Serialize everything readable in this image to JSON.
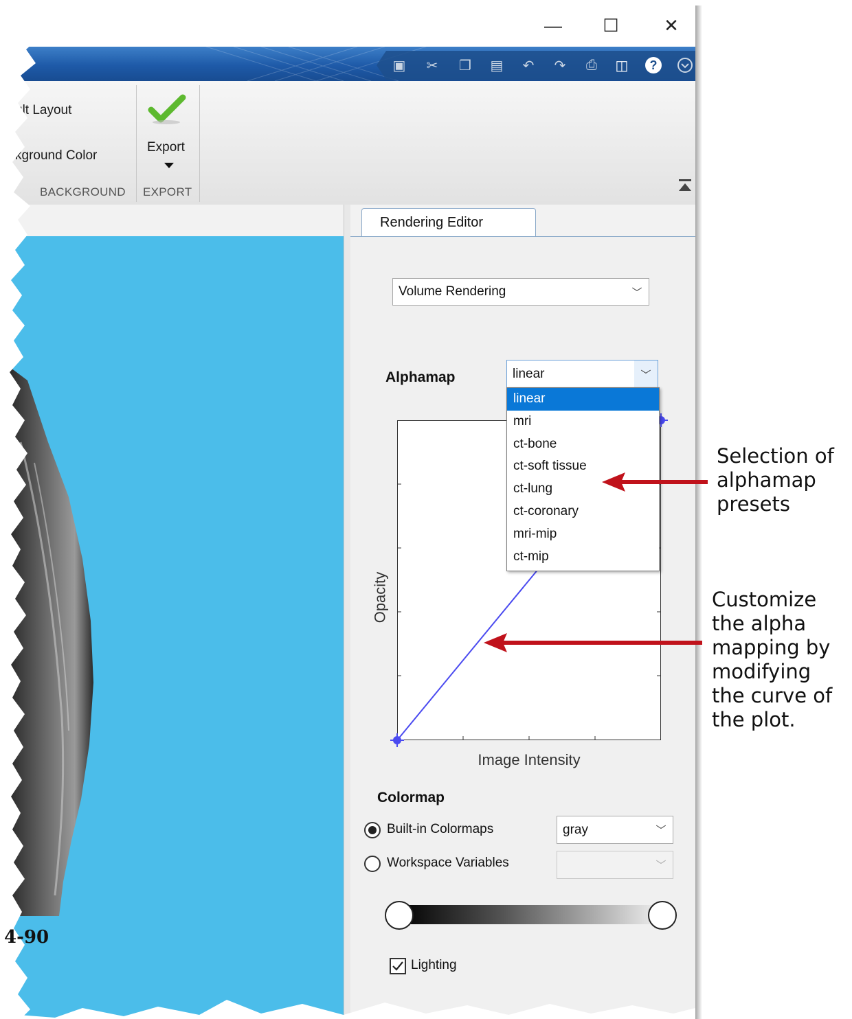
{
  "window_controls": {
    "minimize": "—",
    "maximize": "☐",
    "close": "✕"
  },
  "toolbar": {
    "quick_access_icons": [
      "save-icon",
      "cut-icon",
      "copy-icon",
      "paste-icon",
      "undo-icon",
      "redo-icon",
      "print-icon",
      "window-icon",
      "help-icon",
      "options-icon"
    ]
  },
  "ribbon": {
    "layout_button": "ult Layout",
    "background_color_button": "kground Color",
    "background_section": "BACKGROUND",
    "export_button": "Export",
    "export_section": "EXPORT",
    "accent_check_color": "#5db92f"
  },
  "viewer": {
    "background_color": "#4bbdea"
  },
  "rendering_editor": {
    "tab_label": "Rendering Editor",
    "render_type": "Volume Rendering",
    "alphamap_label": "Alphamap",
    "alphamap_value": "linear",
    "alphamap_options": [
      "linear",
      "mri",
      "ct-bone",
      "ct-soft tissue",
      "ct-lung",
      "ct-coronary",
      "mri-mip",
      "ct-mip"
    ],
    "plot": {
      "xlabel": "Image Intensity",
      "ylabel": "Opacity",
      "curve_color": "#4a4af0"
    },
    "colormap_label": "Colormap",
    "builtin_label": "Built-in Colormaps",
    "builtin_value": "gray",
    "workspace_label": "Workspace Variables",
    "workspace_value": "",
    "lighting_label": "Lighting",
    "lighting_checked": true
  },
  "annotations": {
    "presets": "Selection of\nalphamap\npresets",
    "curve": "Customize\nthe alpha\nmapping by\nmodifying\nthe curve of\nthe plot.",
    "arrow_color": "#c0121b"
  },
  "page_number": "4-90"
}
